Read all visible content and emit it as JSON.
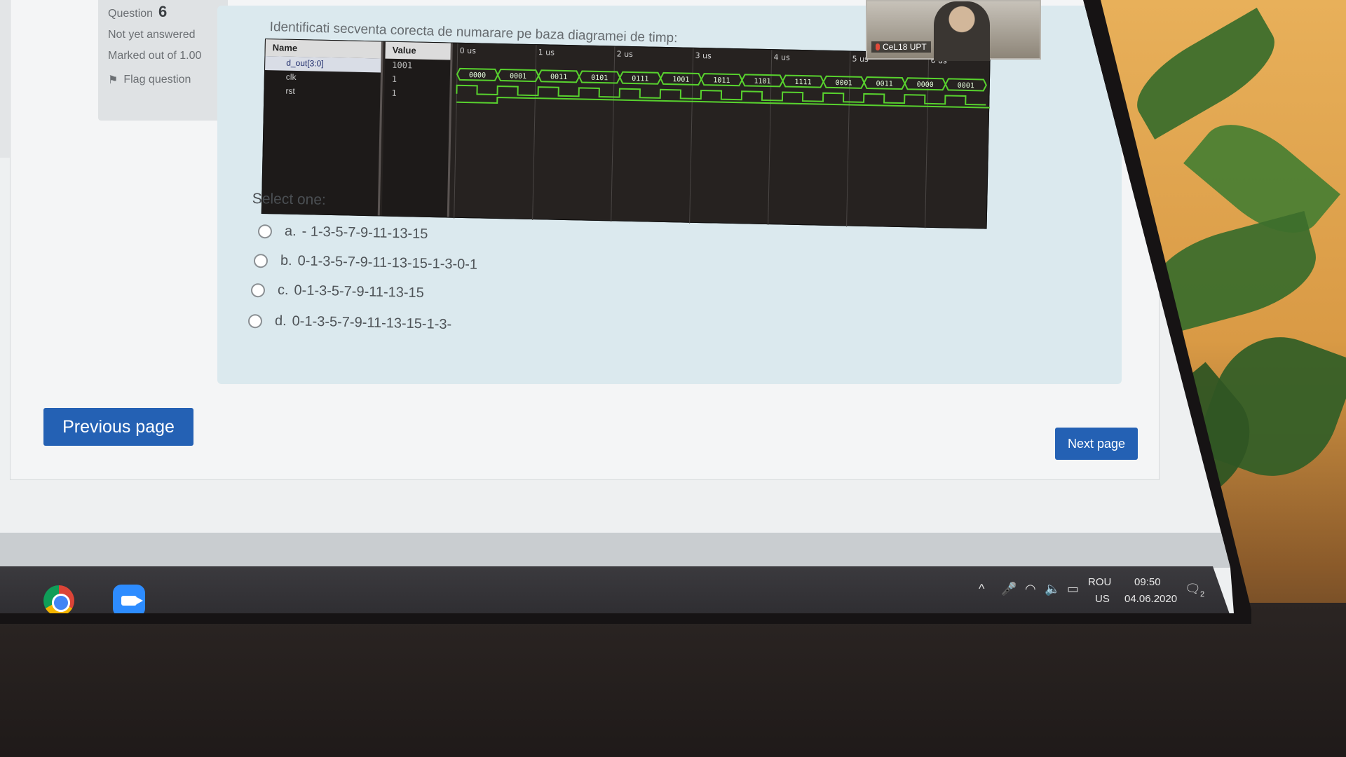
{
  "quiz_info": {
    "question_label": "Question",
    "question_number": "6",
    "status": "Not yet answered",
    "marked": "Marked out of 1.00",
    "flag_label": "Flag question"
  },
  "question": {
    "text": "Identificati secventa corecta de numarare pe baza diagramei de timp:",
    "select_label": "Select one:",
    "options": [
      {
        "letter": "a.",
        "text": "- 1-3-5-7-9-11-13-15"
      },
      {
        "letter": "b.",
        "text": "0-1-3-5-7-9-11-13-15-1-3-0-1"
      },
      {
        "letter": "c.",
        "text": "0-1-3-5-7-9-11-13-15"
      },
      {
        "letter": "d.",
        "text": "0-1-3-5-7-9-11-13-15-1-3-"
      }
    ]
  },
  "waveform": {
    "name_header": "Name",
    "value_header": "Value",
    "signals": [
      {
        "name": "d_out[3:0]",
        "value": "1001"
      },
      {
        "name": "clk",
        "value": "1"
      },
      {
        "name": "rst",
        "value": "1"
      }
    ],
    "time_labels": [
      "0 us",
      "1 us",
      "2 us",
      "3 us",
      "4 us",
      "5 us",
      "6 us"
    ],
    "bus_values": [
      "0000",
      "0001",
      "0011",
      "0101",
      "0111",
      "1001",
      "1011",
      "1101",
      "1111",
      "0001",
      "0011",
      "0000",
      "0001"
    ]
  },
  "navigation": {
    "previous_label": "Previous page",
    "next_label": "Next page"
  },
  "video": {
    "caption": "CeL18 UPT"
  },
  "taskbar": {
    "lang_top": "ROU",
    "lang_bottom": "US",
    "time": "09:50",
    "date": "04.06.2020",
    "notification_count": "2"
  },
  "colors": {
    "primary_button": "#2461b4",
    "question_bg": "#dbe9ee",
    "wave_green": "#58d22e"
  }
}
